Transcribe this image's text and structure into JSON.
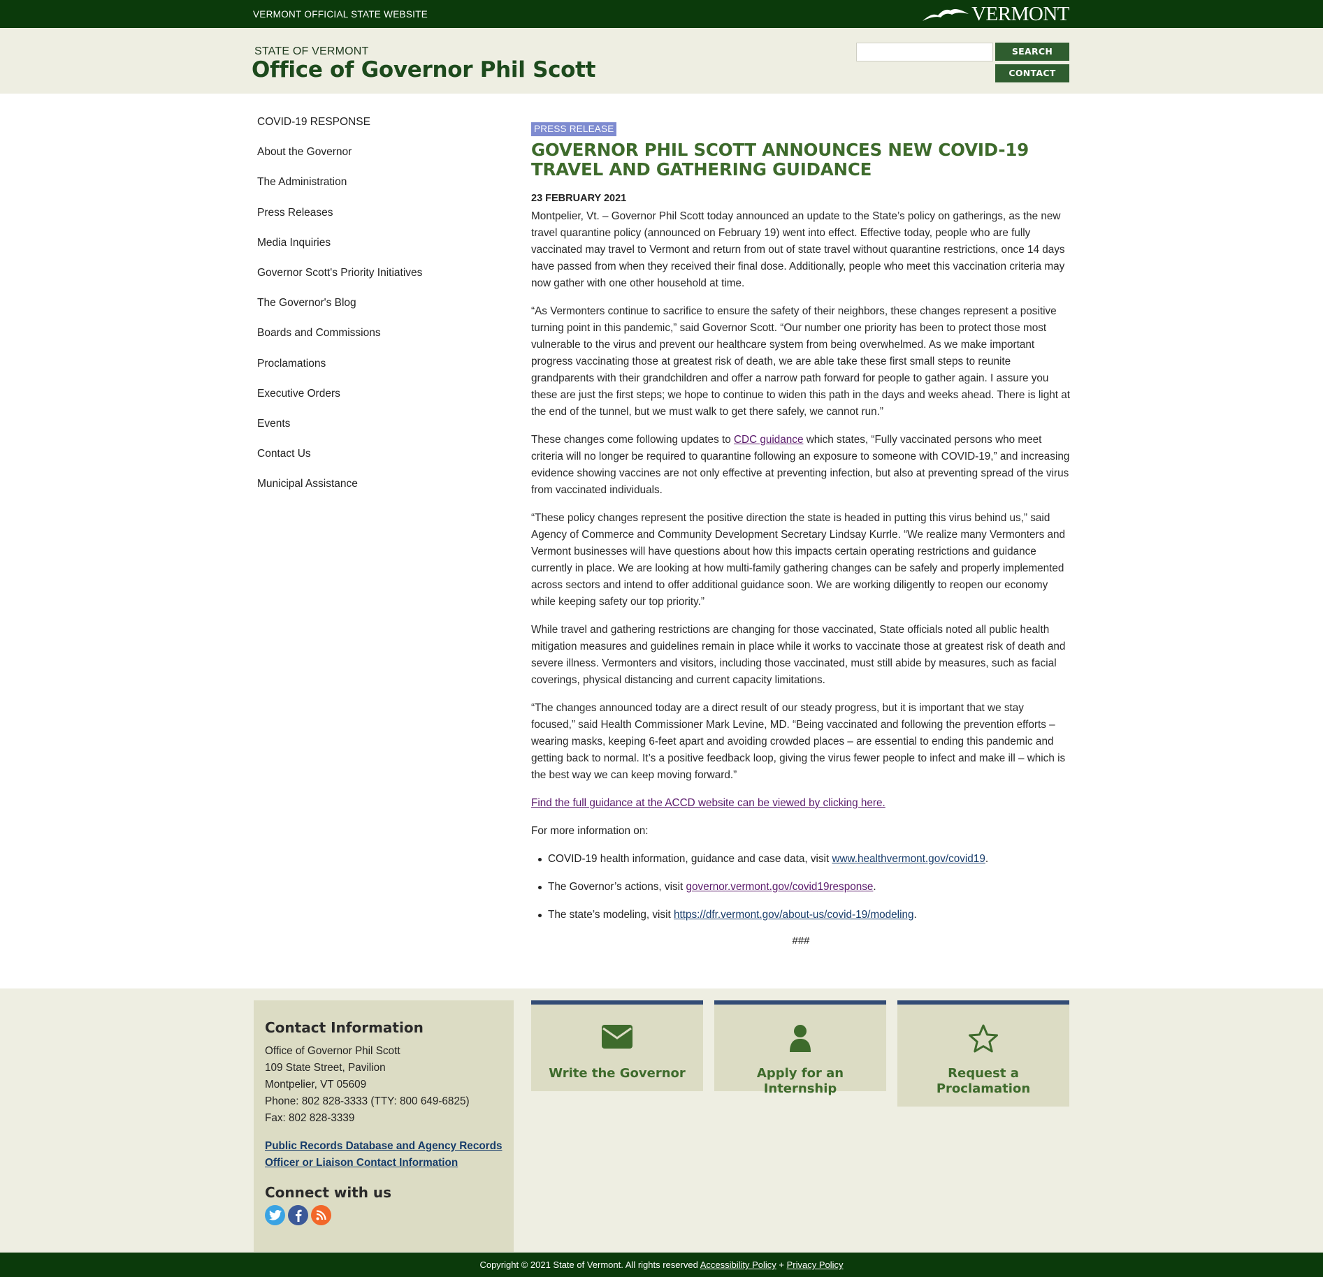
{
  "topbar": {
    "official": "VERMONT OFFICIAL STATE WEBSITE",
    "logo_text": "VERMONT"
  },
  "header": {
    "state": "STATE OF VERMONT",
    "office": "Office of Governor Phil Scott",
    "search_placeholder": "",
    "search_label": "SEARCH",
    "contact_label": "CONTACT"
  },
  "sidenav": [
    "COVID-19 RESPONSE",
    "About the Governor",
    "The Administration",
    "Press Releases",
    "Media Inquiries",
    "Governor Scott's Priority Initiatives",
    "The Governor's Blog",
    "Boards and Commissions",
    "Proclamations",
    "Executive Orders",
    "Events",
    "Contact Us",
    "Municipal Assistance"
  ],
  "article": {
    "tag": "PRESS RELEASE",
    "title": "GOVERNOR PHIL SCOTT ANNOUNCES NEW COVID-19 TRAVEL AND GATHERING GUIDANCE",
    "date": "23 FEBRUARY 2021",
    "p1": "Montpelier, Vt. – Governor Phil Scott today announced an update to the State’s policy on gatherings, as the new travel quarantine policy (announced on February 19) went into effect. Effective today, people who are fully vaccinated may travel to Vermont and return from out of state travel without quarantine restrictions, once 14 days have passed from when they received their final dose. Additionally, people who meet this vaccination criteria may now gather with one other household at time.",
    "p2": "“As Vermonters continue to sacrifice to ensure the safety of their neighbors, these changes represent a positive turning point in this pandemic,” said Governor Scott. “Our number one priority has been to protect those most vulnerable to the virus and prevent our healthcare system from being overwhelmed. As we make important progress vaccinating those at greatest risk of death, we are able take these first small steps to reunite grandparents with their grandchildren and offer a narrow path forward for people to gather again. I assure you these are just the first steps; we hope to continue to widen this path in the days and weeks ahead. There is light at the end of the tunnel, but we must walk to get there safely, we cannot run.”",
    "p3_before": "These changes come following updates to ",
    "p3_link": "CDC guidance",
    "p3_after": " which states, “Fully vaccinated persons who meet criteria will no longer be required to quarantine following an exposure to someone with COVID-19,” and increasing evidence showing vaccines are not only effective at preventing infection, but also at preventing spread of the virus from vaccinated individuals.",
    "p4": "“These policy changes represent the positive direction the state is headed in putting this virus behind us,” said Agency of Commerce and Community Development Secretary Lindsay Kurrle. “We realize many Vermonters and Vermont businesses will have questions about how this impacts certain operating restrictions and guidance currently in place. We are looking at how multi-family gathering changes can be safely and properly implemented across sectors and intend to offer additional guidance soon. We are working diligently to reopen our economy while keeping safety our top priority.”",
    "p5": "While travel and gathering restrictions are changing for those vaccinated, State officials noted all public health mitigation measures and guidelines remain in place while it works to vaccinate those at greatest risk of death and severe illness. Vermonters and visitors, including those vaccinated, must still abide by measures, such as facial coverings, physical distancing and current capacity limitations.",
    "p6": "“The changes announced today are a direct result of our steady progress, but it is important that we stay focused,” said Health Commissioner Mark Levine, MD. “Being vaccinated and following the prevention efforts – wearing masks, keeping 6-feet apart and avoiding crowded places – are essential to ending this pandemic and getting back to normal. It’s a positive feedback loop, giving the virus fewer people to infect and make ill – which is the best way we can keep moving forward.”",
    "full_link": "Find the full guidance at the ACCD website can be viewed by clicking here.",
    "more": "For more information on:",
    "b1_text": "COVID-19 health information, guidance and case data, visit ",
    "b1_link": "www.healthvermont.gov/covid19",
    "b2_text": "The Governor’s actions, visit ",
    "b2_link": "governor.vermont.gov/covid19response",
    "b3_text": "The state’s modeling, visit ",
    "b3_link": "https://dfr.vermont.gov/about-us/covid-19/modeling",
    "period": ".",
    "hashes": "###"
  },
  "footer": {
    "contact_title": "Contact Information",
    "lines": [
      "Office of Governor Phil Scott",
      "109 State Street, Pavilion",
      "Montpelier, VT 05609",
      "Phone: 802 828-3333 (TTY: 800 649-6825)",
      "Fax: 802 828-3339"
    ],
    "records_link": "Public Records Database and Agency Records Officer or Liaison Contact Information",
    "connect": "Connect with us",
    "tiles": [
      "Write the Governor",
      "Apply for an Internship",
      "Request a Proclamation"
    ]
  },
  "bottom": {
    "copyright": "Copyright © 2021 State of Vermont. All rights reserved ",
    "accessibility": "Accessibility Policy",
    "plus": " + ",
    "privacy": "Privacy Policy"
  },
  "colors": {
    "dark_green": "#0b3a0b",
    "title_green": "#3e6b2c",
    "button_green": "#2f5d2f",
    "tag_blue": "#7e8bd0",
    "tile_border": "#334c75"
  }
}
